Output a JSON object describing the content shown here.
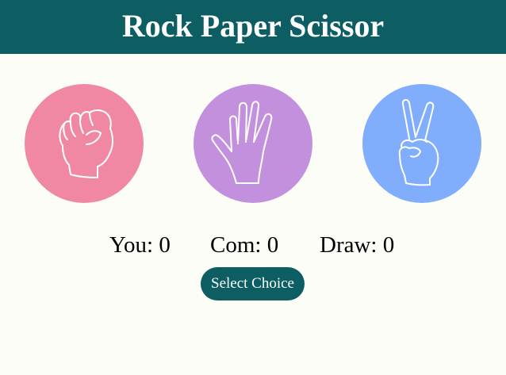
{
  "header": {
    "title": "Rock Paper Scissor"
  },
  "choices": [
    {
      "name": "rock",
      "icon": "fist-icon",
      "color": "#f088a4"
    },
    {
      "name": "paper",
      "icon": "open-hand-icon",
      "color": "#c390de"
    },
    {
      "name": "scissors",
      "icon": "peace-sign-hand-icon",
      "color": "#80aefc"
    }
  ],
  "scoreboard": {
    "you": "You: 0",
    "com": "Com: 0",
    "draw": "Draw: 0"
  },
  "actions": {
    "select_label": "Select Choice"
  },
  "colors": {
    "primary": "#0d5e63",
    "background": "#fdfdf8"
  }
}
